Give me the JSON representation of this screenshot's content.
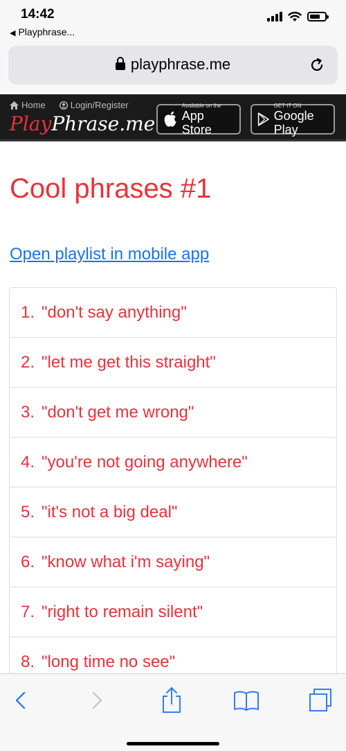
{
  "status_bar": {
    "time": "14:42",
    "back_app": "Playphrase..."
  },
  "browser": {
    "url": "playphrase.me"
  },
  "site_header": {
    "nav": {
      "home": "Home",
      "login": "Login/Register"
    },
    "logo": {
      "play": "Play",
      "phrase": "Phrase.me"
    },
    "app_store": {
      "small": "Available on the",
      "big": "App Store"
    },
    "google_play": {
      "small": "GET IT ON",
      "big": "Google Play"
    }
  },
  "main": {
    "title": "Cool phrases #1",
    "open_link": "Open playlist in mobile app",
    "phrases": [
      {
        "num": "1.",
        "text": "\"don't say anything\""
      },
      {
        "num": "2.",
        "text": "\"let me get this straight\""
      },
      {
        "num": "3.",
        "text": "\"don't get me wrong\""
      },
      {
        "num": "4.",
        "text": "\"you're not going anywhere\""
      },
      {
        "num": "5.",
        "text": "\"it's not a big deal\""
      },
      {
        "num": "6.",
        "text": "\"know what i'm saying\""
      },
      {
        "num": "7.",
        "text": "\"right to remain silent\""
      },
      {
        "num": "8.",
        "text": "\"long time no see\""
      }
    ]
  },
  "colors": {
    "accent": "#e8323c",
    "link": "#1a73e8",
    "ios_blue": "#2f7cf6"
  },
  "toolbar": {
    "icons": [
      "back-icon",
      "forward-icon",
      "share-icon",
      "bookmarks-icon",
      "tabs-icon"
    ]
  }
}
